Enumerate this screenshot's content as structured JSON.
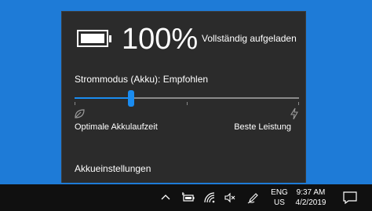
{
  "flyout": {
    "battery_percent": "100%",
    "battery_level": 1.0,
    "status": "Vollständig aufgeladen",
    "power_mode_label": "Strommodus (Akku): Empfohlen",
    "slider": {
      "value_fraction": 0.25,
      "ticks": [
        0,
        0.5,
        1.0
      ]
    },
    "left_label": "Optimale Akkulaufzeit",
    "right_label": "Beste Leistung",
    "left_icon": "leaf-icon",
    "right_icon": "lightning-icon",
    "settings_link": "Akkueinstellungen",
    "accent_color": "#1a8cf0"
  },
  "taskbar": {
    "icons": [
      "chevron-up-icon",
      "battery-plug-icon",
      "wifi-icon",
      "volume-muted-icon",
      "pen-icon"
    ],
    "language_top": "ENG",
    "language_bottom": "US",
    "time": "9:37 AM",
    "date": "4/2/2019",
    "notification_icon": "notification-icon"
  }
}
